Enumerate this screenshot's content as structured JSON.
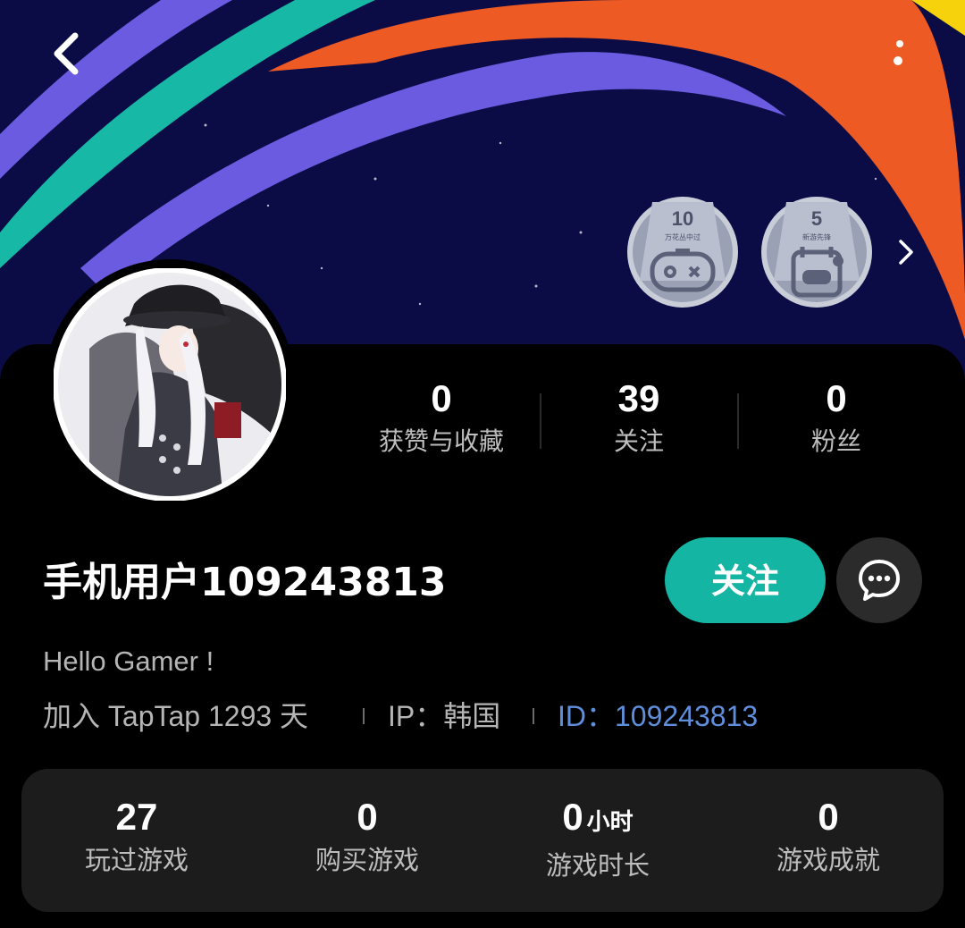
{
  "header": {
    "back_icon": "chevron-left-icon",
    "more_icon": "more-vertical-icon"
  },
  "badges": [
    {
      "count": "10",
      "name": "万花丛中过",
      "icon": "gamepad-icon"
    },
    {
      "count": "5",
      "name": "新游先锋",
      "icon": "calendar-gamepad-icon"
    }
  ],
  "badges_more_icon": "chevron-right-icon",
  "profile_stats": [
    {
      "value": "0",
      "label": "获赞与收藏"
    },
    {
      "value": "39",
      "label": "关注"
    },
    {
      "value": "0",
      "label": "粉丝"
    }
  ],
  "user": {
    "name": "手机用户109243813",
    "bio": "Hello Gamer !",
    "joined": "加入 TapTap 1293 天",
    "ip": "IP：韩国",
    "id": "ID：109243813"
  },
  "actions": {
    "follow_label": "关注",
    "message_icon": "chat-bubble-icon"
  },
  "game_stats": [
    {
      "value": "27",
      "unit": "",
      "label": "玩过游戏"
    },
    {
      "value": "0",
      "unit": "",
      "label": "购买游戏"
    },
    {
      "value": "0",
      "unit": "小时",
      "label": "游戏时长"
    },
    {
      "value": "0",
      "unit": "",
      "label": "游戏成就"
    }
  ],
  "colors": {
    "accent": "#15b5a4",
    "id_link": "#5f8fdc",
    "card_bg": "#1c1c1c",
    "banner_bg": "#0b0c45"
  }
}
